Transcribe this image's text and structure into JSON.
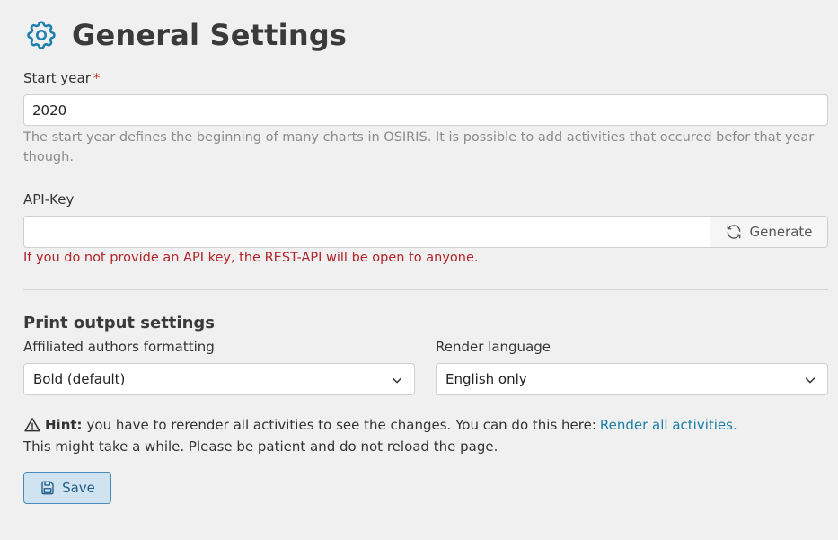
{
  "page": {
    "title": "General Settings",
    "icon": "gear-icon",
    "accent_color": "#1d7fb0"
  },
  "start_year": {
    "label": "Start year",
    "required_marker": "*",
    "value": "2020",
    "help": "The start year defines the beginning of many charts in OSIRIS. It is possible to add activities that occured befor that year though."
  },
  "api_key": {
    "label": "API-Key",
    "value": "",
    "generate_label": "Generate",
    "generate_icon": "refresh-icon",
    "warning": "If you do not provide an API key, the REST-API will be open to anyone."
  },
  "print_output": {
    "heading": "Print output settings",
    "authors_label": "Affiliated authors formatting",
    "authors_value": "Bold (default)",
    "language_label": "Render language",
    "language_value": "English only"
  },
  "hint": {
    "icon": "warning-icon",
    "prefix": "Hint:",
    "text": "you have to rerender all activities to see the changes. You can do this here:",
    "link": "Render all activities.",
    "line2": "This might take a while. Please be patient and do not reload the page."
  },
  "save": {
    "label": "Save",
    "icon": "save-icon"
  }
}
